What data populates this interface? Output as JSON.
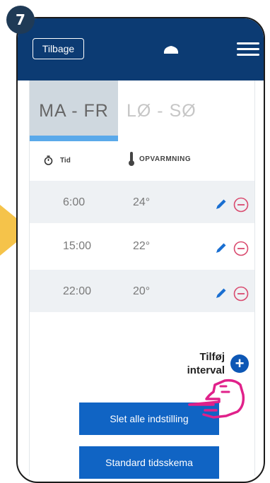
{
  "step": {
    "number": "7"
  },
  "header": {
    "back_label": "Tilbage",
    "device_icon": "thermostat-icon",
    "menu_icon": "hamburger-menu-icon"
  },
  "tabs": [
    {
      "label": "MA - FR",
      "active": true
    },
    {
      "label": "LØ - SØ",
      "active": false
    }
  ],
  "columns": {
    "time": "Tid",
    "heating": "OPVARMNING"
  },
  "schedule": [
    {
      "time": "6:00",
      "temp": "24°"
    },
    {
      "time": "15:00",
      "temp": "22°"
    },
    {
      "time": "22:00",
      "temp": "20°"
    }
  ],
  "add_interval": {
    "label_line1": "Tilføj",
    "label_line2": "interval"
  },
  "buttons": {
    "delete_all": "Slet alle indstilling",
    "standard": "Standard tidsskema"
  },
  "colors": {
    "topbar": "#0c3b73",
    "accent_tab": "#5aa9ea",
    "button": "#1064c4",
    "remove": "#d94a6e",
    "edit": "#1a6fd1",
    "arrow": "#f5c34a",
    "hand": "#e0218a"
  }
}
